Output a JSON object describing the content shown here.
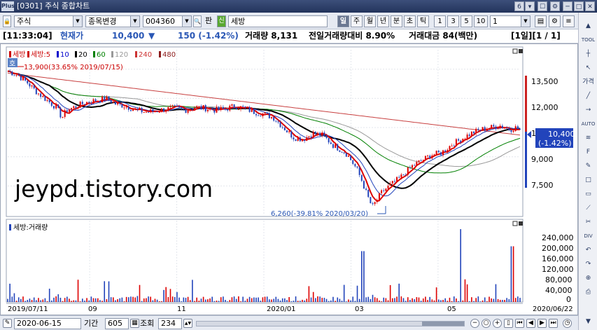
{
  "window": {
    "logo": "Plus",
    "title": "[0301] 주식 종합차트",
    "page_num": "6",
    "controls": [
      "6",
      "▾",
      "☐",
      "⚙",
      "─",
      "□",
      "✕"
    ]
  },
  "toolbar": {
    "market": "주식",
    "code_change_label": "종목변경",
    "stock_code": "004360",
    "pan_label": "판",
    "sin_label": "신",
    "stock_name": "세방",
    "periods": [
      "일",
      "주",
      "월",
      "년",
      "분",
      "초",
      "틱"
    ],
    "active_period": "일",
    "nums": [
      "1",
      "3",
      "5",
      "10"
    ],
    "interval_value": "1",
    "icons": [
      "save-icon",
      "settings-icon",
      "list-icon"
    ]
  },
  "info": {
    "time": "[11:33:04]",
    "current_label": "현재가",
    "price": "10,400",
    "arrow": "▼",
    "change": "150  (-1.42%)",
    "volume": "거래량 8,131",
    "prev_volume_ratio": "전일거래량대비 8.90%",
    "amount": "거래대금 84(백만)",
    "page": "[1일][1 / 1]"
  },
  "price_panel": {
    "legend": [
      "세방",
      "세방:5",
      "10",
      "20",
      "60",
      "120",
      "240",
      "480"
    ],
    "legend_colors": [
      "#cc0000",
      "#cc0000",
      "#0000cc",
      "#000000",
      "#008000",
      "#999999",
      "#cc3333",
      "#8b1a1a"
    ],
    "high_badge": "호",
    "high_annotation": "13,900(33.65% 2019/07/15)",
    "low_annotation": "6,260(-39.81% 2020/03/20)",
    "y_ticks": [
      "13,500",
      "12,000",
      "10,500",
      "9,000",
      "7,500"
    ],
    "current_price_label": "10,400",
    "current_change_label": "(-1.42%)",
    "watermark": "jeypd.tistory.com"
  },
  "volume_panel": {
    "legend": "세방:거래량",
    "y_ticks": [
      "240,000",
      "200,000",
      "160,000",
      "120,000",
      "80,000",
      "40,000",
      "0"
    ]
  },
  "x_axis": {
    "labels": [
      "2019/07/11",
      "09",
      "11",
      "2020/01",
      "03",
      "05"
    ],
    "end_label": "2020/06/22"
  },
  "bottom": {
    "date": "2020-06-15",
    "period_label": "기간",
    "period_value": "605",
    "view_label": "조회",
    "view_value": "234"
  },
  "sidebar": {
    "icons": [
      "up-arrow-icon",
      "tool-icon",
      "crosshair-icon",
      "cursor-icon",
      "text-icon",
      "line-icon",
      "ray-icon",
      "auto-icon",
      "channel-icon",
      "fibonacci-icon",
      "draw-icon",
      "shape-icon",
      "rect-icon",
      "trend-icon",
      "delete-icon",
      "divide-icon",
      "undo-icon",
      "redo-icon",
      "zoom-icon",
      "print-icon",
      "down-arrow-icon"
    ],
    "labels": [
      "▲",
      "TOOL",
      "┼",
      "↖",
      "가격",
      "╱",
      "→",
      "AUTO",
      "≋",
      "F",
      "✎",
      "□",
      "▭",
      "⟋",
      "✂",
      "DIV",
      "↶",
      "↷",
      "⊕",
      "⎙",
      "▼"
    ]
  },
  "chart_data": {
    "type": "candlestick",
    "x_start": "2019/07/11",
    "x_end": "2020/06/22",
    "y_price_range": [
      6000,
      14500
    ],
    "y_volume_range": [
      0,
      260000
    ],
    "price_path": [
      [
        0,
        13400
      ],
      [
        10,
        13200
      ],
      [
        20,
        12800
      ],
      [
        30,
        12300
      ],
      [
        40,
        11900
      ],
      [
        50,
        11500
      ],
      [
        55,
        11000
      ],
      [
        60,
        11400
      ],
      [
        70,
        11600
      ],
      [
        80,
        11800
      ],
      [
        90,
        11900
      ],
      [
        100,
        12000
      ],
      [
        110,
        11700
      ],
      [
        120,
        11600
      ],
      [
        130,
        11400
      ],
      [
        140,
        11300
      ],
      [
        150,
        11350
      ],
      [
        160,
        11450
      ],
      [
        170,
        11500
      ],
      [
        180,
        11400
      ],
      [
        190,
        11550
      ],
      [
        200,
        11500
      ],
      [
        210,
        11400
      ],
      [
        220,
        11450
      ],
      [
        230,
        11600
      ],
      [
        240,
        11500
      ],
      [
        250,
        11300
      ],
      [
        260,
        11200
      ],
      [
        270,
        11000
      ],
      [
        280,
        10500
      ],
      [
        290,
        10000
      ],
      [
        300,
        9900
      ],
      [
        310,
        10200
      ],
      [
        320,
        10100
      ],
      [
        330,
        9600
      ],
      [
        340,
        9300
      ],
      [
        345,
        9100
      ],
      [
        350,
        8700
      ],
      [
        355,
        8300
      ],
      [
        360,
        7700
      ],
      [
        365,
        7000
      ],
      [
        370,
        6400
      ],
      [
        375,
        6800
      ],
      [
        380,
        7200
      ],
      [
        390,
        7600
      ],
      [
        400,
        8000
      ],
      [
        410,
        8500
      ],
      [
        420,
        8800
      ],
      [
        430,
        9100
      ],
      [
        440,
        9200
      ],
      [
        450,
        9600
      ],
      [
        460,
        9900
      ],
      [
        470,
        10200
      ],
      [
        480,
        10400
      ],
      [
        490,
        10500
      ],
      [
        500,
        10600
      ],
      [
        510,
        10400
      ],
      [
        515,
        10500
      ],
      [
        520,
        10400
      ]
    ],
    "high": {
      "value": 13900,
      "date": "2019/07/15",
      "change_pct": 33.65
    },
    "low": {
      "value": 6260,
      "date": "2020/03/20",
      "change_pct": -39.81
    },
    "current": 10400,
    "moving_averages": [
      "5",
      "10",
      "20",
      "60",
      "120",
      "240",
      "480"
    ],
    "volume_spikes": [
      {
        "pos": 0.69,
        "value": 178000
      },
      {
        "pos": 0.88,
        "value": 255000
      },
      {
        "pos": 0.98,
        "value": 195000
      }
    ]
  }
}
